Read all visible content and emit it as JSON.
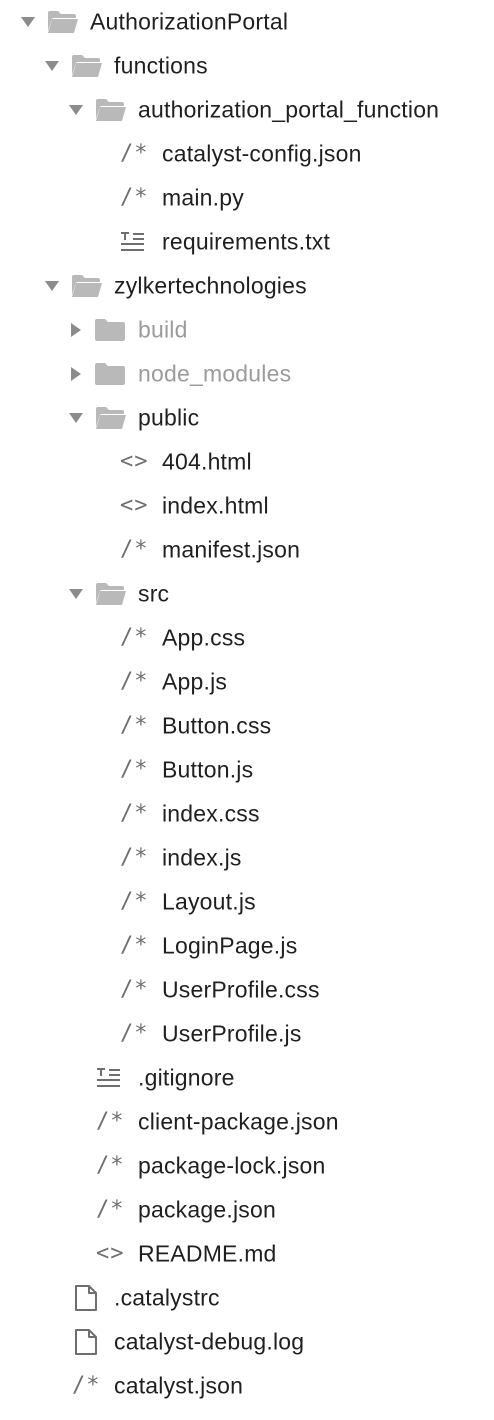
{
  "tree": {
    "root": {
      "label": "AuthorizationPortal"
    },
    "functions": {
      "label": "functions"
    },
    "authorization_portal_function": {
      "label": "authorization_portal_function"
    },
    "catalyst_config_json": {
      "label": "catalyst-config.json",
      "icon": "/*"
    },
    "main_py": {
      "label": "main.py",
      "icon": "/*"
    },
    "requirements_txt": {
      "label": "requirements.txt"
    },
    "zylkertechnologies": {
      "label": "zylkertechnologies"
    },
    "build": {
      "label": "build"
    },
    "node_modules": {
      "label": "node_modules"
    },
    "public": {
      "label": "public"
    },
    "file_404_html": {
      "label": "404.html",
      "icon": "<>"
    },
    "index_html": {
      "label": "index.html",
      "icon": "<>"
    },
    "manifest_json": {
      "label": "manifest.json",
      "icon": "/*"
    },
    "src": {
      "label": "src"
    },
    "app_css": {
      "label": "App.css",
      "icon": "/*"
    },
    "app_js": {
      "label": "App.js",
      "icon": "/*"
    },
    "button_css": {
      "label": "Button.css",
      "icon": "/*"
    },
    "button_js": {
      "label": "Button.js",
      "icon": "/*"
    },
    "index_css": {
      "label": "index.css",
      "icon": "/*"
    },
    "index_js": {
      "label": "index.js",
      "icon": "/*"
    },
    "layout_js": {
      "label": "Layout.js",
      "icon": "/*"
    },
    "loginpage_js": {
      "label": "LoginPage.js",
      "icon": "/*"
    },
    "userprofile_css": {
      "label": "UserProfile.css",
      "icon": "/*"
    },
    "userprofile_js": {
      "label": "UserProfile.js",
      "icon": "/*"
    },
    "gitignore": {
      "label": ".gitignore"
    },
    "client_package_json": {
      "label": "client-package.json",
      "icon": "/*"
    },
    "package_lock_json": {
      "label": "package-lock.json",
      "icon": "/*"
    },
    "package_json": {
      "label": "package.json",
      "icon": "/*"
    },
    "readme_md": {
      "label": "README.md",
      "icon": "<>"
    },
    "catalystrc": {
      "label": ".catalystrc"
    },
    "catalyst_debug_log": {
      "label": "catalyst-debug.log"
    },
    "catalyst_json": {
      "label": "catalyst.json",
      "icon": "/*"
    }
  },
  "colors": {
    "folder_icon": "#b9b9b9",
    "chevron": "#8c8c8c",
    "text": "#1f1f1f",
    "dimmed_text": "#9b9b9b",
    "glyph_icon": "#6f6f6f"
  }
}
